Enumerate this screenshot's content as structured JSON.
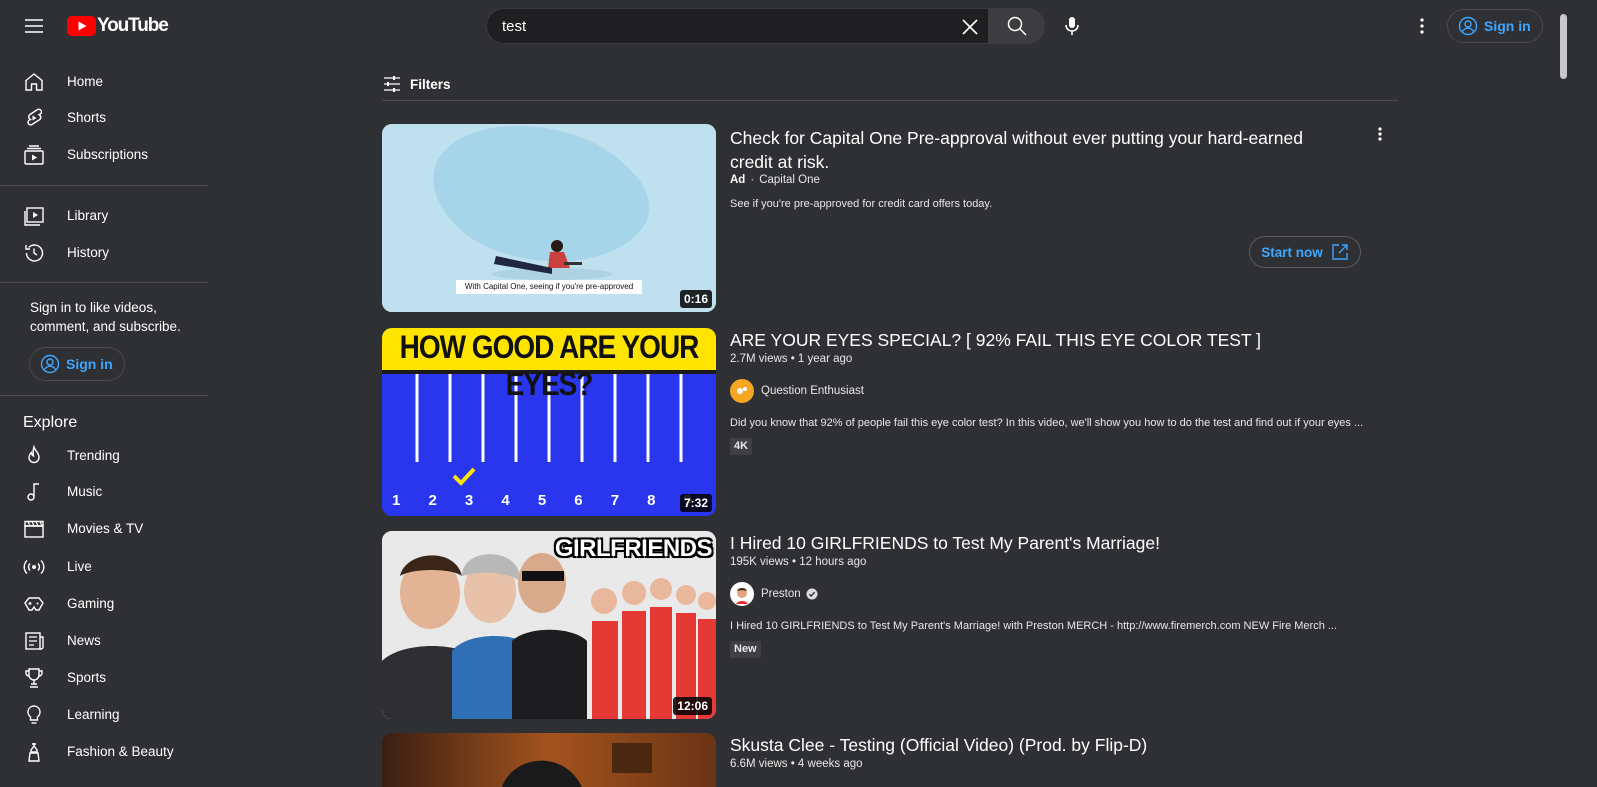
{
  "header": {
    "logo_text": "YouTube",
    "search_value": "test",
    "signin_label": "Sign in"
  },
  "sidebar": {
    "top_items": [
      {
        "label": "Home"
      },
      {
        "label": "Shorts"
      },
      {
        "label": "Subscriptions"
      }
    ],
    "mid_items": [
      {
        "label": "Library"
      },
      {
        "label": "History"
      }
    ],
    "signin_message": "Sign in to like videos, comment, and subscribe.",
    "signin_label": "Sign in",
    "explore_title": "Explore",
    "explore_items": [
      {
        "label": "Trending"
      },
      {
        "label": "Music"
      },
      {
        "label": "Movies & TV"
      },
      {
        "label": "Live"
      },
      {
        "label": "Gaming"
      },
      {
        "label": "News"
      },
      {
        "label": "Sports"
      },
      {
        "label": "Learning"
      },
      {
        "label": "Fashion & Beauty"
      }
    ]
  },
  "filters": {
    "label": "Filters"
  },
  "results": [
    {
      "title": "Check for Capital One Pre-approval without ever putting your hard-earned credit at risk.",
      "ad_label": "Ad",
      "channel": "Capital One",
      "description": "See if you're pre-approved for credit card offers today.",
      "cta": "Start now",
      "duration": "0:16",
      "thumb_caption": "With Capital One, seeing if you're pre-approved"
    },
    {
      "title": "ARE YOUR EYES SPECIAL? [ 92% FAIL THIS EYE COLOR TEST ]",
      "meta": "2.7M views • 1 year ago",
      "channel": "Question Enthusiast",
      "description": "Did you know that 92% of people fail this eye color test? In this video, we'll show you how to do the test and find out if your eyes ...",
      "badge": "4K",
      "duration": "7:32",
      "thumb_heading": "HOW GOOD ARE YOUR EYES?",
      "thumb_numbers": [
        "1",
        "2",
        "3",
        "4",
        "5",
        "6",
        "7",
        "8",
        "9"
      ]
    },
    {
      "title": "I Hired 10 GIRLFRIENDS to Test My Parent's Marriage!",
      "meta": "195K views • 12 hours ago",
      "channel": "Preston",
      "description": "I Hired 10 GIRLFRIENDS to Test My Parent's Marriage! with Preston MERCH - http://www.firemerch.com NEW Fire Merch ...",
      "badge": "New",
      "duration": "12:06",
      "thumb_heading": "GIRLFRIENDS"
    },
    {
      "title": "Skusta Clee - Testing (Official Video) (Prod. by Flip-D)",
      "meta": "6.6M views • 4 weeks ago"
    }
  ],
  "colors": {
    "background": "#2f3033",
    "accent_blue": "#3ea6ff",
    "youtube_red": "#ff0000"
  }
}
